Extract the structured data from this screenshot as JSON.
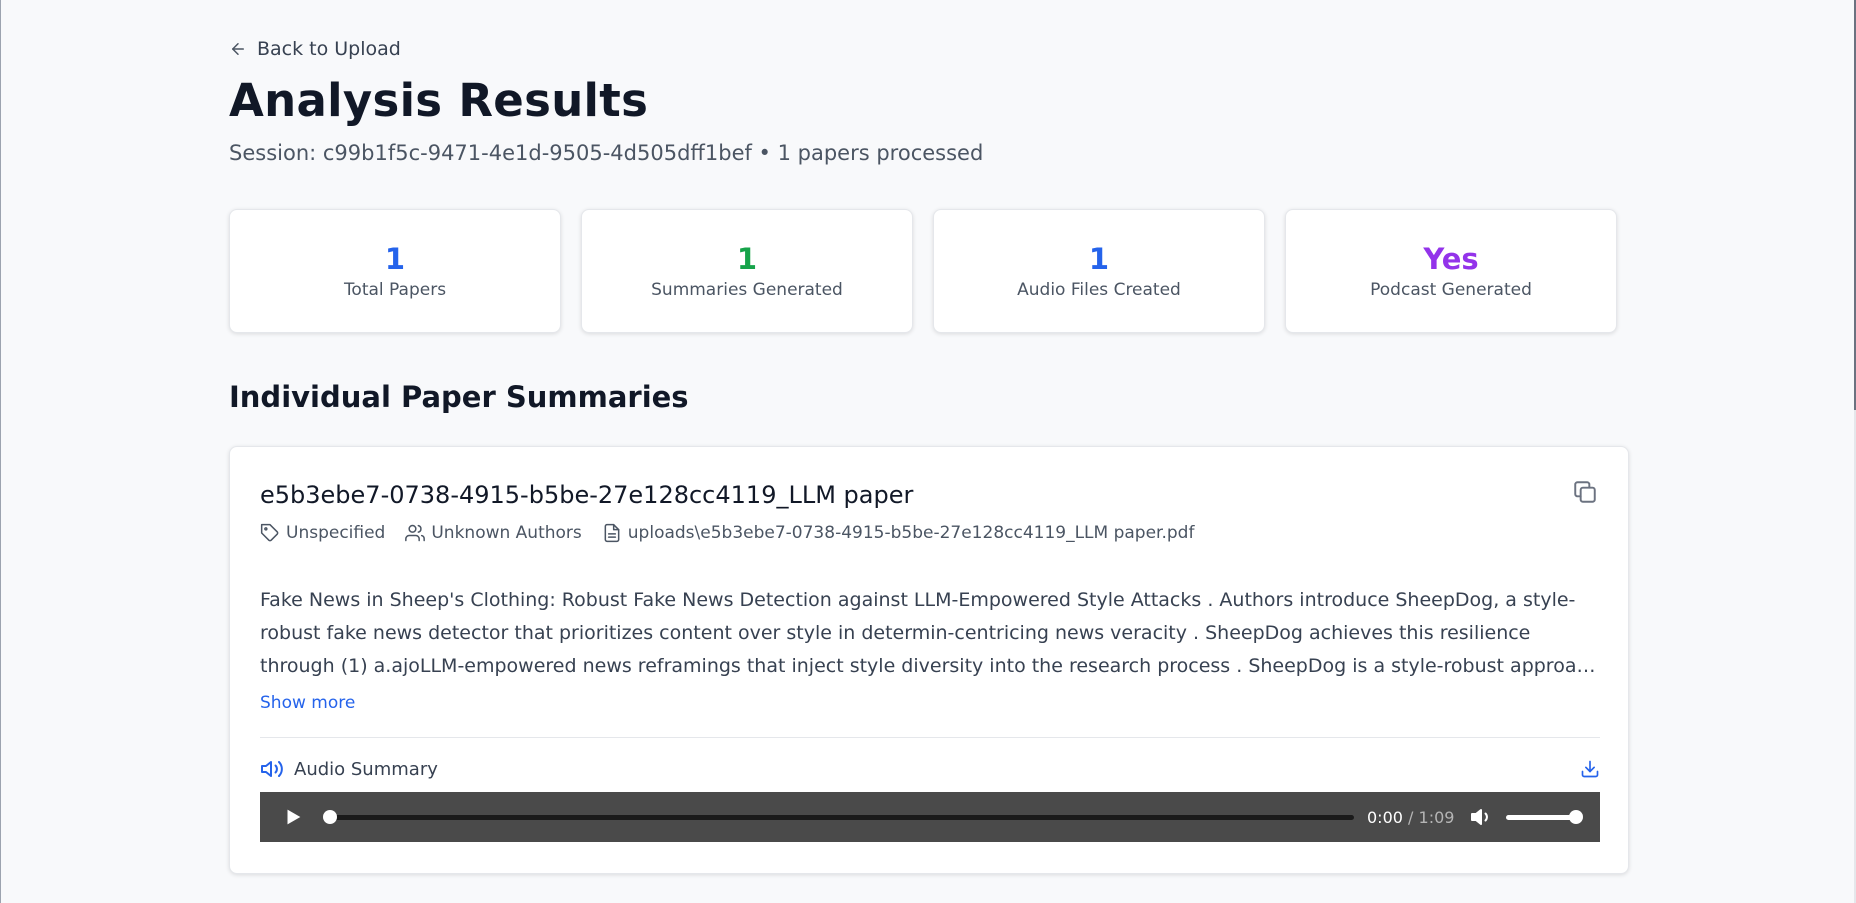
{
  "nav": {
    "back_label": "Back to Upload"
  },
  "page": {
    "title": "Analysis Results",
    "session_text": "Session: c99b1f5c-9471-4e1d-9505-4d505dff1bef • 1 papers processed"
  },
  "stats": [
    {
      "value": "1",
      "label": "Total Papers",
      "color": "#2563eb"
    },
    {
      "value": "1",
      "label": "Summaries Generated",
      "color": "#16a34a"
    },
    {
      "value": "1",
      "label": "Audio Files Created",
      "color": "#2563eb"
    },
    {
      "value": "Yes",
      "label": "Podcast Generated",
      "color": "#9333ea"
    }
  ],
  "section": {
    "title": "Individual Paper Summaries"
  },
  "paper": {
    "title": "e5b3ebe7-0738-4915-b5be-27e128cc4119_LLM paper",
    "category": "Unspecified",
    "authors": "Unknown Authors",
    "file_path": "uploads\\e5b3ebe7-0738-4915-b5be-27e128cc4119_LLM paper.pdf",
    "summary": "Fake News in Sheep's Clothing: Robust Fake News Detection against LLM-Empowered Style Attacks . Authors introduce SheepDog, a style-robust fake news detector that prioritizes content over style in determin-centricing news veracity . SheepDog achieves this resilience through (1) a.ajoLLM-empowered news reframings that inject style diversity into the research process . SheepDog is a style-robust approach that consistently recognises trustworthy content regardless of the style in which it is presented.",
    "show_more_label": "Show more",
    "audio": {
      "label": "Audio Summary",
      "current_time": "0:00",
      "separator": "/",
      "duration": "1:09",
      "progress": 0,
      "volume": 1
    }
  },
  "colors": {
    "accent": "#2563eb",
    "text": "#111827",
    "muted": "#4b5563"
  },
  "icons": [
    "arrow-left-icon",
    "copy-icon",
    "tag-icon",
    "users-icon",
    "file-icon",
    "volume-icon",
    "download-icon",
    "play-icon",
    "speaker-icon"
  ]
}
